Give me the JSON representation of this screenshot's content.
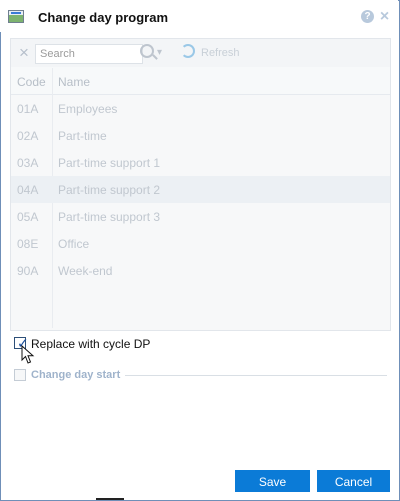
{
  "window": {
    "title": "Change day program",
    "icons": [
      "program-icon",
      "help-icon",
      "close-icon"
    ]
  },
  "toolbar": {
    "search_placeholder": "Search",
    "refresh_label": "Refresh",
    "icons": [
      "clear-icon",
      "search-icon",
      "dropdown-icon",
      "refresh-icon"
    ]
  },
  "table": {
    "headers": [
      "Code",
      "Name"
    ],
    "rows": [
      {
        "code": "01A",
        "name": "Employees"
      },
      {
        "code": "02A",
        "name": "Part-time"
      },
      {
        "code": "03A",
        "name": "Part-time support 1"
      },
      {
        "code": "04A",
        "name": "Part-time support 2"
      },
      {
        "code": "05A",
        "name": "Part-time support 3"
      },
      {
        "code": "08E",
        "name": "Office"
      },
      {
        "code": "90A",
        "name": "Week-end"
      }
    ],
    "selected_row_code": "04A"
  },
  "options": {
    "replace_with_cycle": {
      "label": "Replace with cycle DP",
      "checked": true
    },
    "change_day_start": {
      "label": "Change day start",
      "checked": false,
      "disabled": true
    }
  },
  "buttons": {
    "save": "Save",
    "cancel": "Cancel"
  },
  "colors": {
    "accent": "#0b7bd7",
    "disabled_text": "#a9b2bd",
    "checkbox_border": "#2d4f78"
  }
}
